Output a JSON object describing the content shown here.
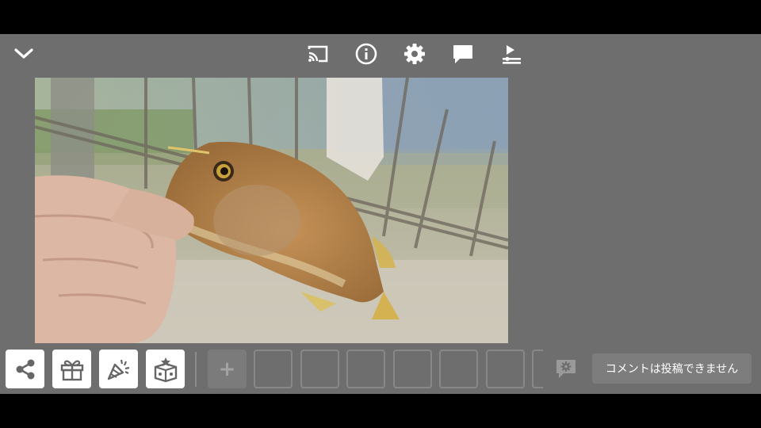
{
  "top_bar": {
    "icons": [
      "chevron-down-icon",
      "cast-icon",
      "info-icon",
      "gear-icon",
      "chat-icon",
      "playlist-icon"
    ]
  },
  "video": {
    "subject": "photo"
  },
  "bottom_bar": {
    "action_icons": [
      "share-icon",
      "gift-icon",
      "party-popper-icon",
      "gift-box-icon"
    ],
    "add_slot_label": "+",
    "empty_slots": 7,
    "comment_placeholder": "コメントは投稿できません"
  },
  "colors": {
    "background": "#000000",
    "panel": "#6e6e6e",
    "tile": "#ffffff",
    "comment_box": "#7d7d7d"
  }
}
